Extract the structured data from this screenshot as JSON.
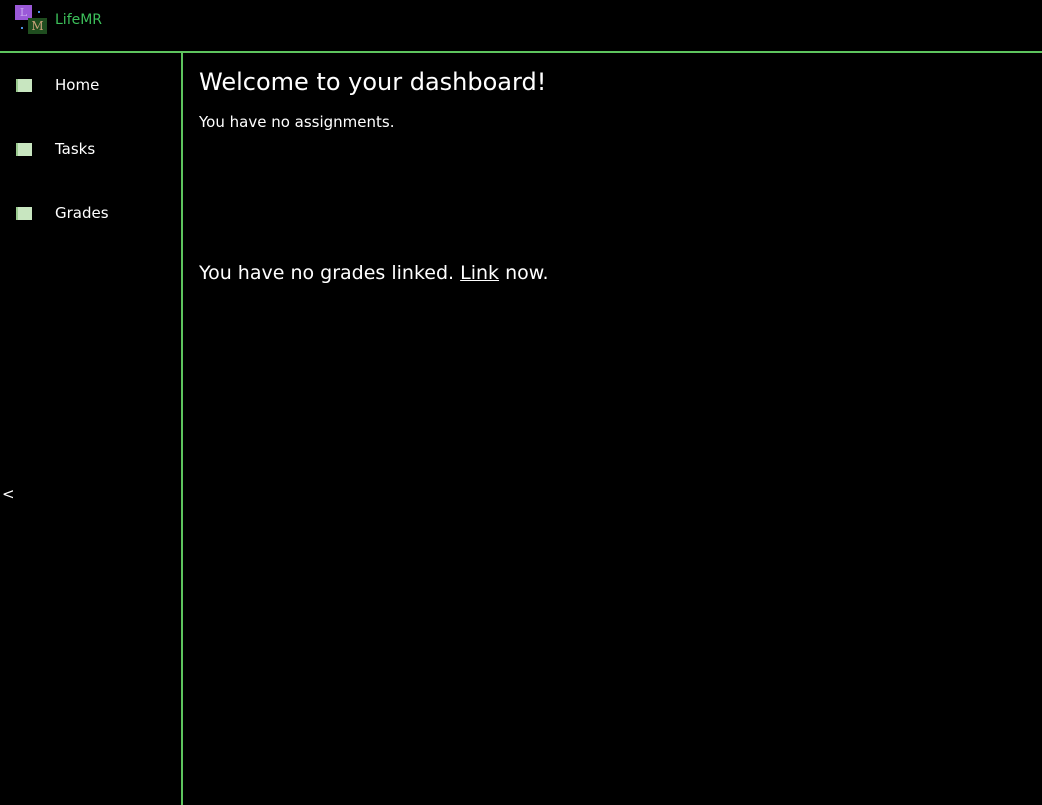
{
  "header": {
    "logo_letter_top": "L",
    "logo_letter_bottom": "M",
    "brand_name": "LifeMR"
  },
  "sidebar": {
    "items": [
      {
        "label": "Home",
        "icon": "page-icon"
      },
      {
        "label": "Tasks",
        "icon": "page-icon"
      },
      {
        "label": "Grades",
        "icon": "page-icon"
      }
    ],
    "collapse_label": "<"
  },
  "main": {
    "welcome_title": "Welcome to your dashboard!",
    "assignments_text": "You have no assignments.",
    "grades_text_before": "You have no grades linked.",
    "grades_link_label": "Link",
    "grades_text_after": "now."
  },
  "colors": {
    "accent_green": "#5ec45e",
    "brand_green": "#3cbf5a",
    "background": "#000000",
    "text": "#ffffff"
  }
}
